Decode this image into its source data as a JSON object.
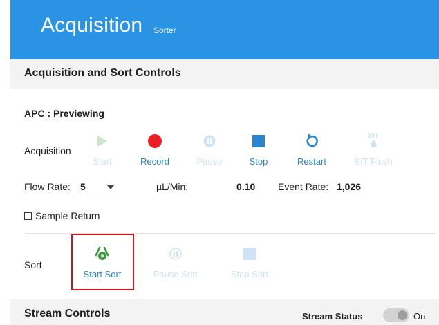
{
  "header": {
    "title": "Acquisition",
    "subtitle": "Sorter"
  },
  "acq_section": {
    "title": "Acquisition and Sort Controls"
  },
  "status": "APC : Previewing",
  "acquisition": {
    "label": "Acquisition",
    "controls": [
      {
        "label": "Start",
        "icon": "play-icon",
        "enabled": false
      },
      {
        "label": "Record",
        "icon": "record-icon",
        "enabled": true
      },
      {
        "label": "Pause",
        "icon": "pause-icon",
        "enabled": false
      },
      {
        "label": "Stop",
        "icon": "stop-icon",
        "enabled": true
      },
      {
        "label": "Restart",
        "icon": "restart-icon",
        "enabled": true
      },
      {
        "label": "SIT Flush",
        "icon": "sit-flush-icon",
        "icon_text": "SIT",
        "enabled": false
      }
    ]
  },
  "flow": {
    "rate_label": "Flow Rate:",
    "rate_value": "5",
    "unit_label": "µL/Min:",
    "unit_value": "0.10",
    "event_label": "Event Rate:",
    "event_value": "1,026"
  },
  "sample_return": {
    "label": "Sample Return",
    "checked": false
  },
  "sort": {
    "label": "Sort",
    "controls": [
      {
        "label": "Start Sort",
        "icon": "start-sort-icon",
        "enabled": true
      },
      {
        "label": "Pause Sort",
        "icon": "pause-icon",
        "enabled": false
      },
      {
        "label": "Stop Sort",
        "icon": "stop-icon",
        "enabled": false
      }
    ]
  },
  "stream_section": {
    "title": "Stream Controls",
    "status_label": "Stream Status",
    "toggle_label": "On"
  },
  "colors": {
    "header_bg": "#2a93e4",
    "enabled_blue": "#2a84cf",
    "disabled_blue": "#cfe3f5",
    "record_red": "#ee1c24",
    "play_green_disabled": "#c8e6c9",
    "sort_green": "#3d9b3d",
    "highlight_red": "#d8131b"
  }
}
